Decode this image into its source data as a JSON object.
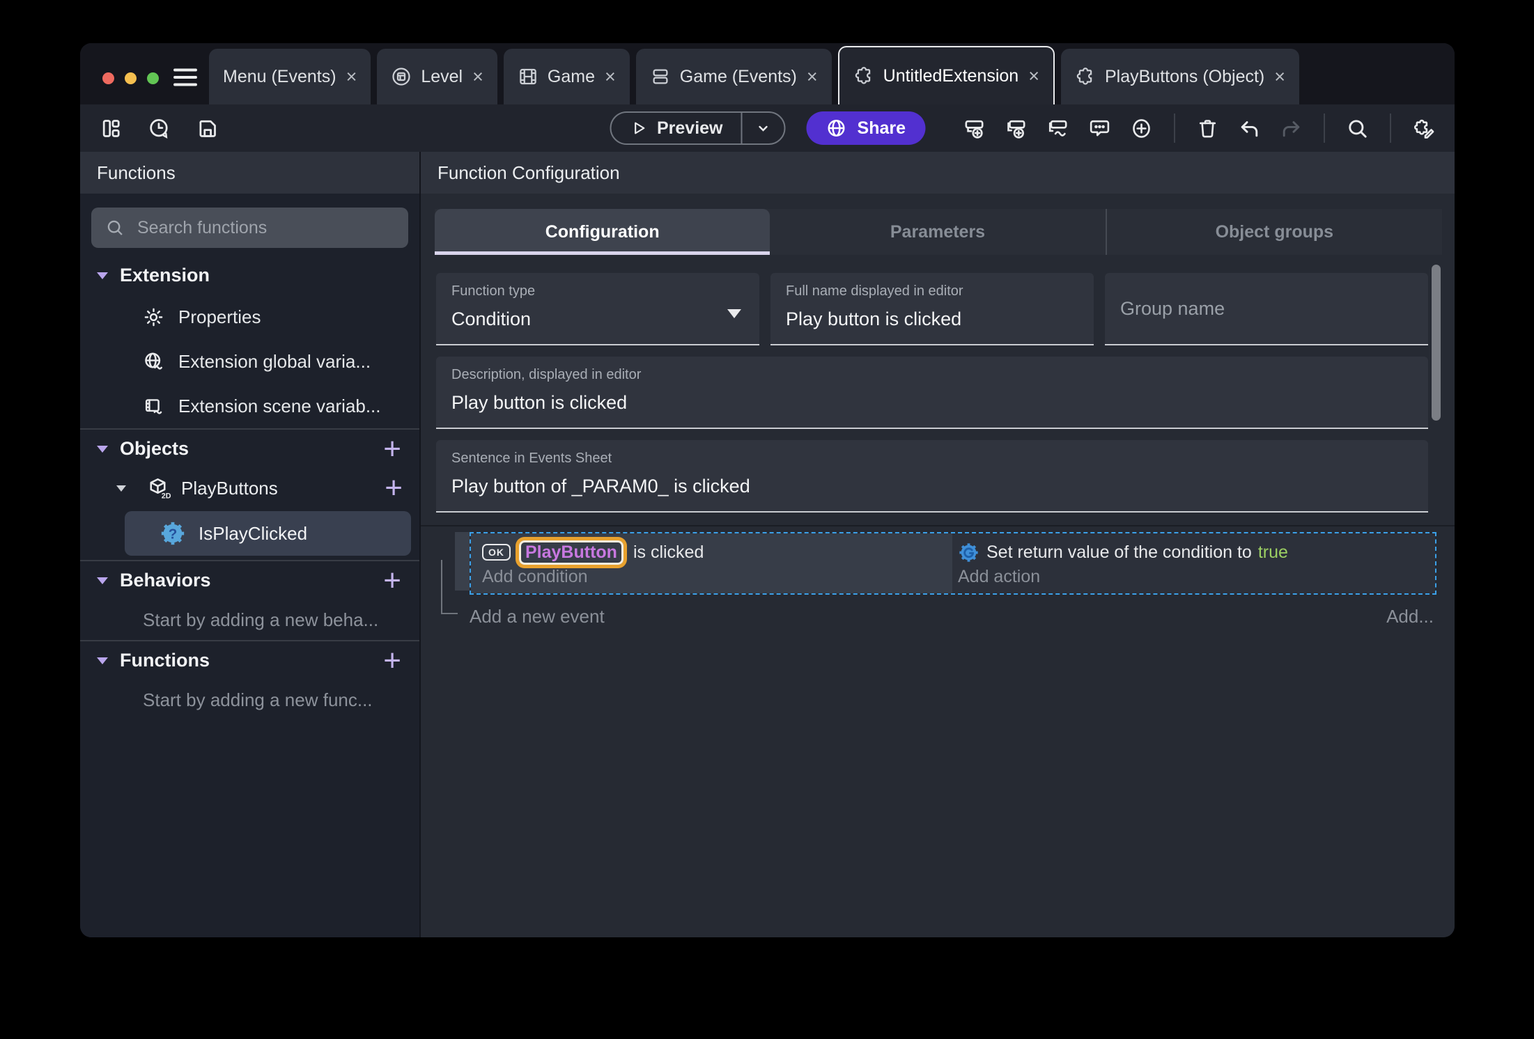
{
  "titlebar": {
    "tabs": [
      {
        "label": "Menu (Events)"
      },
      {
        "label": "Level"
      },
      {
        "label": "Game"
      },
      {
        "label": "Game (Events)"
      },
      {
        "label": "UntitledExtension"
      },
      {
        "label": "PlayButtons (Object)"
      }
    ]
  },
  "glyphs": {
    "close": "×",
    "plus": "+"
  },
  "toolbar": {
    "preview": "Preview",
    "share": "Share"
  },
  "sidebar": {
    "header": "Functions",
    "search_placeholder": "Search functions",
    "extension": {
      "label": "Extension",
      "items": [
        {
          "label": "Properties"
        },
        {
          "label": "Extension global varia..."
        },
        {
          "label": "Extension scene variab..."
        }
      ]
    },
    "objects": {
      "label": "Objects",
      "object": "PlayButtons",
      "badge": "2D",
      "function": "IsPlayClicked"
    },
    "behaviors": {
      "label": "Behaviors",
      "empty": "Start by adding a new beha..."
    },
    "functions": {
      "label": "Functions",
      "empty": "Start by adding a new func..."
    }
  },
  "main": {
    "header": "Function Configuration",
    "tabs": [
      {
        "label": "Configuration"
      },
      {
        "label": "Parameters"
      },
      {
        "label": "Object groups"
      }
    ],
    "fields": {
      "function_type": {
        "label": "Function type",
        "value": "Condition"
      },
      "full_name": {
        "label": "Full name displayed in editor",
        "value": "Play button is clicked"
      },
      "group_name": {
        "placeholder": "Group name"
      },
      "description": {
        "label": "Description, displayed in editor",
        "value": "Play button is clicked"
      },
      "sentence": {
        "label": "Sentence in Events Sheet",
        "value": "Play button of _PARAM0_ is clicked"
      }
    },
    "events": {
      "condition_object_chip": "OK",
      "condition_object": "PlayButton",
      "condition_text": "is clicked",
      "add_condition": "Add condition",
      "action_text": "Set return value of the condition to",
      "action_value": "true",
      "add_action": "Add action",
      "add_new_event": "Add a new event",
      "add_more": "Add..."
    }
  },
  "colors": {
    "accent_purple": "#5230d0",
    "selection_blue": "#3ba0e8",
    "object_purple": "#c878e0",
    "highlight_orange": "#e8a12e",
    "true_green": "#9ccf63",
    "lavender": "#b9a5ec",
    "window_bg": "#262a33",
    "sidebar_bg": "#1d212b"
  },
  "icons": {
    "hamburger-icon": "≡",
    "window-icon": "scene tab",
    "film-icon": "game tab",
    "events-sheet-icon": "stacked rows",
    "puzzle-icon": "extension",
    "layout-icon": "home layout",
    "history-icon": "recent projects",
    "save-icon": "floppy",
    "play-icon": "▶",
    "chevron-down-icon": "⌄",
    "globe-icon": "web",
    "add-event-icon": "event +",
    "add-subevent-icon": "sub-event +",
    "add-other-event-icon": "event ~",
    "comment-icon": "💬",
    "circle-plus-icon": "⊕",
    "trash-icon": "🗑",
    "undo-icon": "↶",
    "redo-icon": "↷",
    "search-icon": "🔍",
    "edit-extension-icon": "puzzle + pencil",
    "gear-icon": "⚙",
    "globe-variable-icon": "globe ~",
    "scene-variable-icon": "film ~",
    "cube-2d-icon": "2D cube",
    "condition-function-icon": "blue gear ?",
    "button-object-icon": "OK button",
    "return-value-icon": "blue gear"
  }
}
